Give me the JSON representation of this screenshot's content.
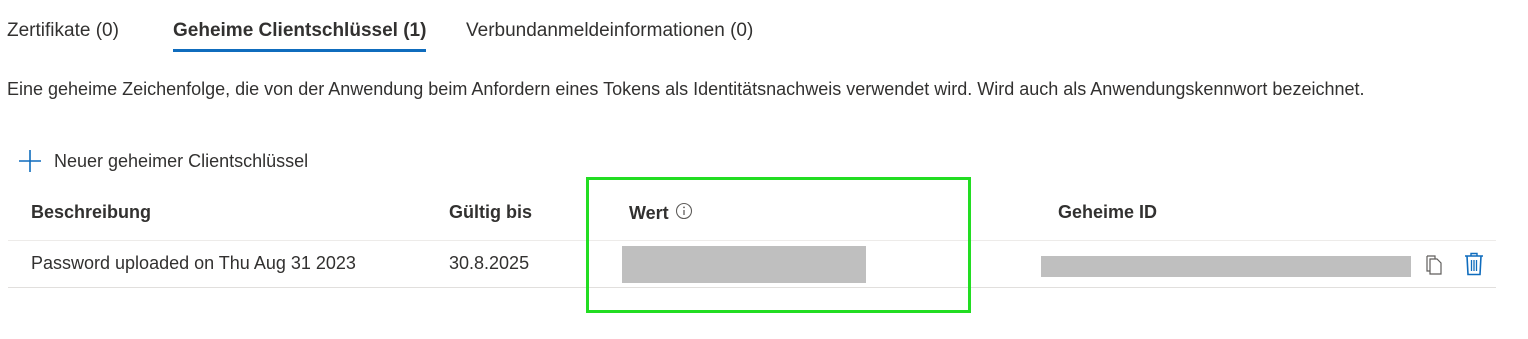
{
  "tabs": [
    {
      "label": "Zertifikate (0)",
      "active": false
    },
    {
      "label": "Geheime Clientschlüssel (1)",
      "active": true
    },
    {
      "label": "Verbundanmeldeinformationen (0)",
      "active": false
    }
  ],
  "description": "Eine geheime Zeichenfolge, die von der Anwendung beim Anfordern eines Tokens als Identitätsnachweis verwendet wird. Wird auch als Anwendungskennwort bezeichnet.",
  "toolbar": {
    "add_label": "Neuer geheimer Clientschlüssel",
    "add_icon": "plus-icon"
  },
  "table": {
    "columns": [
      "Beschreibung",
      "Gültig bis",
      "Wert",
      "Geheime ID"
    ],
    "wert_info_icon": "info-icon",
    "rows": [
      {
        "beschreibung": "Password uploaded on Thu Aug 31 2023",
        "gueltig_bis": "30.8.2025",
        "wert": "",
        "geheime_id": "",
        "icons": [
          "copy-icon",
          "trash-icon"
        ]
      }
    ]
  },
  "colors": {
    "accent": "#0f6cbd",
    "highlight": "#22dd22",
    "redaction": "#bfbfbf"
  }
}
